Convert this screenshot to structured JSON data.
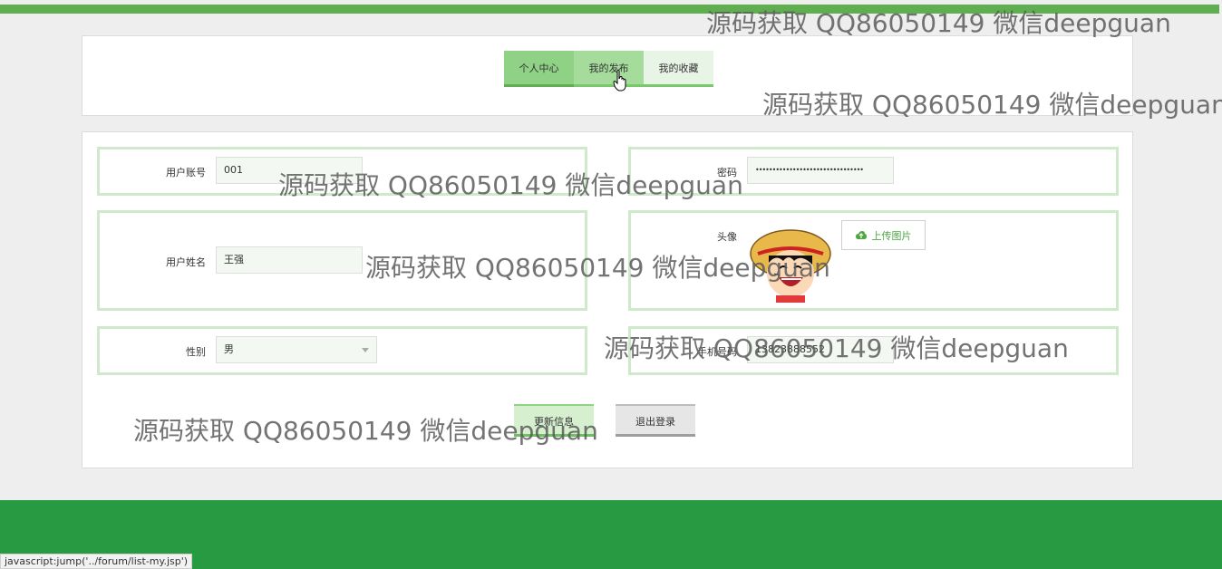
{
  "tabs": [
    {
      "label": "个人中心"
    },
    {
      "label": "我的发布"
    },
    {
      "label": "我的收藏"
    }
  ],
  "form": {
    "account": {
      "label": "用户账号",
      "value": "001"
    },
    "password": {
      "label": "密码",
      "value": "••••••••••••••••••••••••••••••••"
    },
    "name": {
      "label": "用户姓名",
      "value": "王强"
    },
    "avatar": {
      "label": "头像",
      "upload_label": "上传图片"
    },
    "gender": {
      "label": "性别",
      "value": "男"
    },
    "phone": {
      "label": "手机号码",
      "value": "13823888552"
    }
  },
  "buttons": {
    "update": "更新信息",
    "logout": "退出登录"
  },
  "status_bar": "javascript:jump('../forum/list-my.jsp')",
  "watermark": "源码获取 QQ86050149 微信deepguan",
  "colors": {
    "accent": "#5fae4f",
    "footer": "#289a42",
    "field_border": "#cfeacb"
  }
}
